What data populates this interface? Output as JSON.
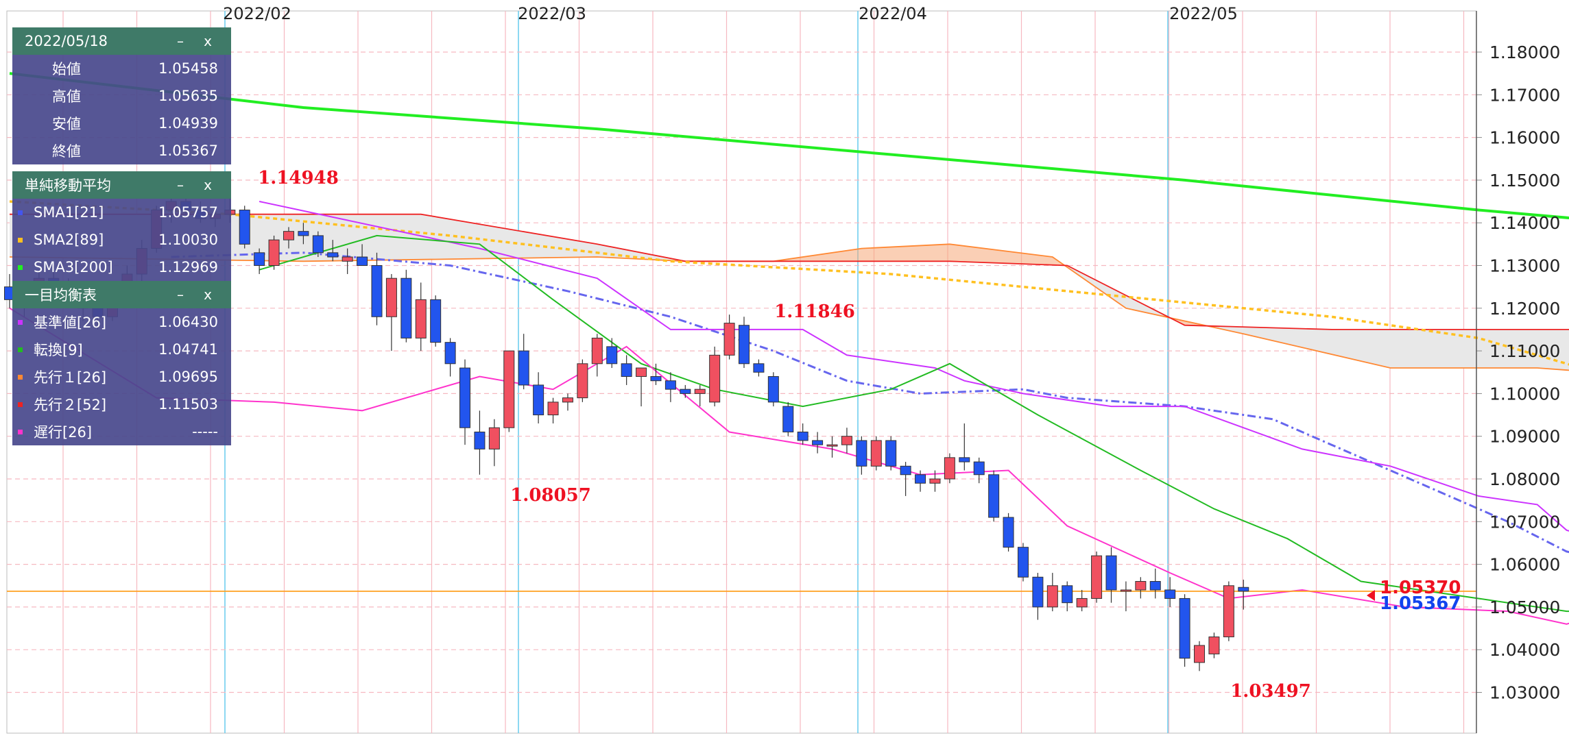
{
  "ohlc_panel": {
    "title": "2022/05/18",
    "minimize": "–",
    "close": "x",
    "rows": [
      {
        "label": "始値",
        "value": "1.05458"
      },
      {
        "label": "高値",
        "value": "1.05635"
      },
      {
        "label": "安値",
        "value": "1.04939"
      },
      {
        "label": "終値",
        "value": "1.05367"
      }
    ]
  },
  "sma_panel": {
    "title": "単純移動平均",
    "minimize": "–",
    "close": "x",
    "rows": [
      {
        "label": "SMA1[21]",
        "value": "1.05757",
        "color": "#4455ee"
      },
      {
        "label": "SMA2[89]",
        "value": "1.10030",
        "color": "#ffc020"
      },
      {
        "label": "SMA3[200]",
        "value": "1.12969",
        "color": "#22ee22"
      }
    ]
  },
  "ichimoku_panel": {
    "title": "一目均衡表",
    "minimize": "–",
    "close": "x",
    "rows": [
      {
        "label": "基準値[26]",
        "value": "1.06430",
        "color": "#cc33ff"
      },
      {
        "label": "転換[9]",
        "value": "1.04741",
        "color": "#22bb22"
      },
      {
        "label": "先行１[26]",
        "value": "1.09695",
        "color": "#ff8833"
      },
      {
        "label": "先行２[52]",
        "value": "1.11503",
        "color": "#ee2222"
      },
      {
        "label": "遅行[26]",
        "value": "-----",
        "color": "#ff33cc"
      }
    ]
  },
  "annotations": {
    "high1": "1.14948",
    "high2": "1.11846",
    "low1": "1.08057",
    "low2": "1.03497",
    "last_ask": "1.05370",
    "last_bid": "1.05367"
  },
  "colors": {
    "up": "#f05060",
    "down": "#2255ee",
    "grid": "#f6b8c0",
    "month_line": "#66ccee"
  },
  "chart_data": {
    "type": "candlestick",
    "x_month_labels": [
      "2022/02",
      "2022/03",
      "2022/04",
      "2022/05"
    ],
    "y_ticks": [
      "1.18000",
      "1.17000",
      "1.16000",
      "1.15000",
      "1.14000",
      "1.13000",
      "1.12000",
      "1.11000",
      "1.10000",
      "1.09000",
      "1.08000",
      "1.07000",
      "1.06000",
      "1.05000",
      "1.04000",
      "1.03000"
    ],
    "ylim": [
      1.024,
      1.185
    ],
    "current_price": 1.0537,
    "candles": [
      [
        1.125,
        1.128,
        1.12,
        1.122
      ],
      [
        1.122,
        1.126,
        1.118,
        1.124
      ],
      [
        1.124,
        1.129,
        1.121,
        1.127
      ],
      [
        1.127,
        1.13,
        1.123,
        1.125
      ],
      [
        1.125,
        1.127,
        1.12,
        1.122
      ],
      [
        1.122,
        1.124,
        1.117,
        1.12
      ],
      [
        1.12,
        1.123,
        1.115,
        1.118
      ],
      [
        1.118,
        1.126,
        1.117,
        1.124
      ],
      [
        1.124,
        1.13,
        1.122,
        1.128
      ],
      [
        1.128,
        1.136,
        1.126,
        1.134
      ],
      [
        1.134,
        1.144,
        1.133,
        1.143
      ],
      [
        1.143,
        1.147,
        1.14,
        1.145
      ],
      [
        1.145,
        1.148,
        1.142,
        1.143
      ],
      [
        1.143,
        1.145,
        1.14,
        1.141
      ],
      [
        1.141,
        1.144,
        1.139,
        1.142
      ],
      [
        1.142,
        1.1495,
        1.14,
        1.143
      ],
      [
        1.143,
        1.144,
        1.134,
        1.135
      ],
      [
        1.133,
        1.134,
        1.128,
        1.13
      ],
      [
        1.13,
        1.137,
        1.129,
        1.136
      ],
      [
        1.136,
        1.139,
        1.134,
        1.138
      ],
      [
        1.138,
        1.14,
        1.135,
        1.137
      ],
      [
        1.137,
        1.138,
        1.132,
        1.133
      ],
      [
        1.133,
        1.136,
        1.131,
        1.132
      ],
      [
        1.131,
        1.134,
        1.128,
        1.132
      ],
      [
        1.132,
        1.135,
        1.13,
        1.13
      ],
      [
        1.13,
        1.133,
        1.116,
        1.118
      ],
      [
        1.118,
        1.128,
        1.11,
        1.127
      ],
      [
        1.127,
        1.129,
        1.112,
        1.113
      ],
      [
        1.113,
        1.126,
        1.11,
        1.122
      ],
      [
        1.122,
        1.123,
        1.111,
        1.112
      ],
      [
        1.112,
        1.113,
        1.104,
        1.107
      ],
      [
        1.106,
        1.108,
        1.088,
        1.092
      ],
      [
        1.091,
        1.096,
        1.081,
        1.087
      ],
      [
        1.087,
        1.094,
        1.083,
        1.092
      ],
      [
        1.092,
        1.11,
        1.091,
        1.11
      ],
      [
        1.11,
        1.114,
        1.101,
        1.102
      ],
      [
        1.102,
        1.105,
        1.093,
        1.095
      ],
      [
        1.095,
        1.099,
        1.093,
        1.098
      ],
      [
        1.098,
        1.1,
        1.096,
        1.099
      ],
      [
        1.099,
        1.108,
        1.098,
        1.107
      ],
      [
        1.107,
        1.114,
        1.104,
        1.113
      ],
      [
        1.111,
        1.113,
        1.106,
        1.107
      ],
      [
        1.107,
        1.109,
        1.102,
        1.104
      ],
      [
        1.104,
        1.106,
        1.097,
        1.106
      ],
      [
        1.104,
        1.107,
        1.102,
        1.103
      ],
      [
        1.103,
        1.105,
        1.098,
        1.101
      ],
      [
        1.101,
        1.102,
        1.099,
        1.1
      ],
      [
        1.1,
        1.102,
        1.097,
        1.101
      ],
      [
        1.098,
        1.111,
        1.097,
        1.109
      ],
      [
        1.109,
        1.1185,
        1.108,
        1.1165
      ],
      [
        1.116,
        1.118,
        1.106,
        1.107
      ],
      [
        1.107,
        1.108,
        1.104,
        1.105
      ],
      [
        1.104,
        1.105,
        1.097,
        1.098
      ],
      [
        1.097,
        1.098,
        1.09,
        1.091
      ],
      [
        1.091,
        1.093,
        1.088,
        1.089
      ],
      [
        1.089,
        1.091,
        1.086,
        1.088
      ],
      [
        1.088,
        1.09,
        1.085,
        1.088
      ],
      [
        1.088,
        1.092,
        1.086,
        1.09
      ],
      [
        1.089,
        1.09,
        1.081,
        1.083
      ],
      [
        1.083,
        1.09,
        1.082,
        1.089
      ],
      [
        1.089,
        1.09,
        1.082,
        1.083
      ],
      [
        1.083,
        1.084,
        1.076,
        1.081
      ],
      [
        1.081,
        1.082,
        1.077,
        1.079
      ],
      [
        1.079,
        1.082,
        1.077,
        1.08
      ],
      [
        1.08,
        1.086,
        1.079,
        1.085
      ],
      [
        1.085,
        1.093,
        1.082,
        1.084
      ],
      [
        1.084,
        1.085,
        1.079,
        1.081
      ],
      [
        1.081,
        1.082,
        1.07,
        1.071
      ],
      [
        1.071,
        1.072,
        1.063,
        1.064
      ],
      [
        1.064,
        1.065,
        1.056,
        1.057
      ],
      [
        1.057,
        1.058,
        1.047,
        1.05
      ],
      [
        1.05,
        1.058,
        1.049,
        1.055
      ],
      [
        1.055,
        1.056,
        1.049,
        1.051
      ],
      [
        1.05,
        1.054,
        1.049,
        1.052
      ],
      [
        1.052,
        1.063,
        1.051,
        1.062
      ],
      [
        1.062,
        1.064,
        1.051,
        1.054
      ],
      [
        1.054,
        1.056,
        1.049,
        1.054
      ],
      [
        1.054,
        1.057,
        1.052,
        1.056
      ],
      [
        1.056,
        1.059,
        1.052,
        1.054
      ],
      [
        1.054,
        1.057,
        1.05,
        1.052
      ],
      [
        1.052,
        1.053,
        1.036,
        1.038
      ],
      [
        1.037,
        1.042,
        1.035,
        1.041
      ],
      [
        1.039,
        1.044,
        1.038,
        1.043
      ],
      [
        1.043,
        1.056,
        1.042,
        1.055
      ],
      [
        1.0546,
        1.0564,
        1.0494,
        1.0537
      ]
    ],
    "sma21": [
      [
        11,
        1.132
      ],
      [
        20,
        1.133
      ],
      [
        30,
        1.13
      ],
      [
        38,
        1.124
      ],
      [
        45,
        1.118
      ],
      [
        52,
        1.11
      ],
      [
        57,
        1.103
      ],
      [
        62,
        1.1
      ],
      [
        69,
        1.101
      ],
      [
        72,
        1.099
      ],
      [
        80,
        1.097
      ],
      [
        86,
        1.094
      ],
      [
        90,
        1.088
      ],
      [
        96,
        1.079
      ],
      [
        102,
        1.07
      ],
      [
        106,
        1.063
      ],
      [
        110,
        1.06
      ],
      [
        113,
        1.058
      ]
    ],
    "sma89": [
      [
        0,
        1.145
      ],
      [
        15,
        1.142
      ],
      [
        30,
        1.137
      ],
      [
        45,
        1.131
      ],
      [
        60,
        1.128
      ],
      [
        75,
        1.123
      ],
      [
        90,
        1.118
      ],
      [
        100,
        1.113
      ],
      [
        113,
        1.1
      ]
    ],
    "sma200": [
      [
        0,
        1.175
      ],
      [
        20,
        1.167
      ],
      [
        40,
        1.162
      ],
      [
        60,
        1.156
      ],
      [
        80,
        1.15
      ],
      [
        100,
        1.143
      ],
      [
        120,
        1.137
      ],
      [
        150,
        1.13
      ],
      [
        171,
        1.129
      ]
    ],
    "kijun": [
      [
        17,
        1.145
      ],
      [
        32,
        1.134
      ],
      [
        40,
        1.127
      ],
      [
        45,
        1.115
      ],
      [
        48,
        1.115
      ],
      [
        54,
        1.115
      ],
      [
        57,
        1.109
      ],
      [
        63,
        1.106
      ],
      [
        65,
        1.103
      ],
      [
        69,
        1.1
      ],
      [
        75,
        1.097
      ],
      [
        80,
        1.097
      ],
      [
        88,
        1.087
      ],
      [
        94,
        1.083
      ],
      [
        100,
        1.076
      ],
      [
        104,
        1.074
      ],
      [
        106,
        1.068
      ],
      [
        110,
        1.064
      ],
      [
        113,
        1.064
      ]
    ],
    "tenkan": [
      [
        17,
        1.129
      ],
      [
        25,
        1.137
      ],
      [
        32,
        1.135
      ],
      [
        37,
        1.122
      ],
      [
        43,
        1.107
      ],
      [
        48,
        1.101
      ],
      [
        54,
        1.097
      ],
      [
        60,
        1.101
      ],
      [
        64,
        1.107
      ],
      [
        70,
        1.095
      ],
      [
        77,
        1.082
      ],
      [
        82,
        1.073
      ],
      [
        87,
        1.066
      ],
      [
        92,
        1.056
      ],
      [
        96,
        1.054
      ],
      [
        102,
        1.051
      ],
      [
        106,
        1.049
      ],
      [
        110,
        1.049
      ],
      [
        113,
        1.047
      ]
    ],
    "senkou1": [
      [
        0,
        1.132
      ],
      [
        20,
        1.131
      ],
      [
        40,
        1.132
      ],
      [
        46,
        1.131
      ],
      [
        52,
        1.131
      ],
      [
        58,
        1.134
      ],
      [
        64,
        1.135
      ],
      [
        71,
        1.132
      ],
      [
        76,
        1.12
      ],
      [
        84,
        1.114
      ],
      [
        94,
        1.106
      ],
      [
        104,
        1.106
      ],
      [
        120,
        1.102
      ],
      [
        132,
        1.091
      ],
      [
        152,
        1.087
      ]
    ],
    "senkou2": [
      [
        0,
        1.142
      ],
      [
        28,
        1.142
      ],
      [
        40,
        1.135
      ],
      [
        46,
        1.131
      ],
      [
        54,
        1.131
      ],
      [
        58,
        1.131
      ],
      [
        64,
        1.131
      ],
      [
        72,
        1.13
      ],
      [
        80,
        1.116
      ],
      [
        90,
        1.115
      ],
      [
        110,
        1.115
      ],
      [
        128,
        1.115
      ],
      [
        135,
        1.113
      ],
      [
        145,
        1.113
      ],
      [
        152,
        1.105
      ]
    ],
    "chikou": [
      [
        0,
        1.12
      ],
      [
        10,
        1.099
      ],
      [
        18,
        1.098
      ],
      [
        24,
        1.096
      ],
      [
        32,
        1.104
      ],
      [
        37,
        1.101
      ],
      [
        42,
        1.111
      ],
      [
        49,
        1.091
      ],
      [
        56,
        1.087
      ],
      [
        62,
        1.081
      ],
      [
        68,
        1.082
      ],
      [
        72,
        1.069
      ],
      [
        79,
        1.058
      ],
      [
        83,
        1.052
      ],
      [
        88,
        1.054
      ],
      [
        95,
        1.05
      ],
      [
        102,
        1.049
      ],
      [
        106,
        1.046
      ],
      [
        112,
        1.052
      ],
      [
        116,
        1.049
      ],
      [
        121,
        1.051
      ],
      [
        128,
        1.044
      ],
      [
        135,
        1.045
      ],
      [
        140,
        1.052
      ],
      [
        144,
        1.049
      ],
      [
        150,
        1.051
      ],
      [
        156,
        1.047
      ],
      [
        161,
        1.038
      ],
      [
        166,
        1.043
      ],
      [
        170,
        1.055
      ],
      [
        175,
        1.054
      ]
    ]
  }
}
